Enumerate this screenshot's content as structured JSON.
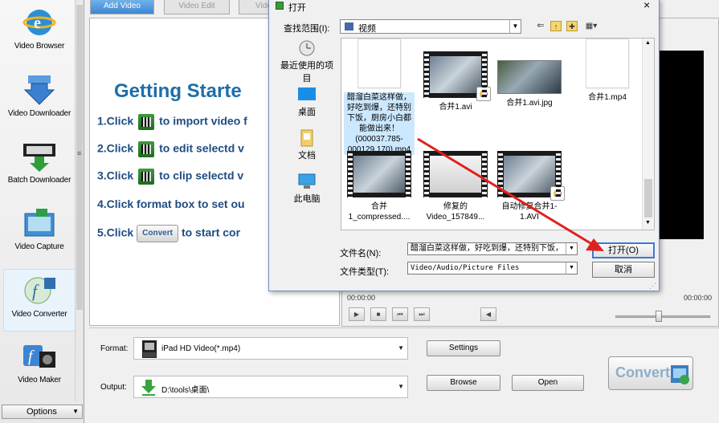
{
  "sidebar": {
    "items": [
      {
        "label": "Video Browser",
        "icon": "globe-icon"
      },
      {
        "label": "Video Downloader",
        "icon": "download-arrow-icon"
      },
      {
        "label": "Batch Downloader",
        "icon": "film-download-icon"
      },
      {
        "label": "Video Capture",
        "icon": "camera-capture-icon"
      },
      {
        "label": "Video Converter",
        "icon": "converter-icon"
      },
      {
        "label": "Video Maker",
        "icon": "video-maker-icon"
      }
    ],
    "options_label": "Options"
  },
  "tabs": [
    {
      "label": "Add Video",
      "active": true
    },
    {
      "label": "Video Edit",
      "active": false
    },
    {
      "label": "Vide",
      "active": false
    }
  ],
  "getting_started": {
    "title": "Getting Starte",
    "steps": [
      {
        "prefix": "1.Click",
        "suffix": "to import video f"
      },
      {
        "prefix": "2.Click",
        "suffix": "to edit selectd v"
      },
      {
        "prefix": "3.Click",
        "suffix": "to clip selectd v"
      },
      {
        "prefix": "4.Click format box to set ou",
        "suffix": ""
      },
      {
        "prefix": "5.Click",
        "button": "Convert",
        "suffix": "to start cor"
      }
    ]
  },
  "player": {
    "time_current": "00:00:00",
    "time_total": "00:00:00",
    "controls": [
      "play",
      "stop",
      "prev",
      "next"
    ],
    "volume_fraction": 0.46
  },
  "bottom": {
    "format_label": "Format:",
    "format_value": "iPad HD Video(*.mp4)",
    "settings_label": "Settings",
    "output_label": "Output:",
    "output_value": "D:\\tools\\桌面\\",
    "browse_label": "Browse",
    "open_label": "Open",
    "convert_label": "Convert"
  },
  "dialog": {
    "title": "打开",
    "close": "×",
    "lookin_label": "查找范围(I):",
    "lookin_value": "视频",
    "places": [
      {
        "label": "最近使用的项目",
        "icon": "recent-items-icon"
      },
      {
        "label": "桌面",
        "icon": "desktop-icon"
      },
      {
        "label": "文档",
        "icon": "documents-icon"
      },
      {
        "label": "此电脑",
        "icon": "this-pc-icon"
      }
    ],
    "files": [
      {
        "caption": "醋溜白菜这样做，好吃到爆，还特别下饭，厨房小白都能做出来！(000037.785-000129.170).mp4",
        "type": "doc",
        "selected": true
      },
      {
        "caption": "合并1.avi",
        "type": "video"
      },
      {
        "caption": "合并1.avi.jpg",
        "type": "image"
      },
      {
        "caption": "合井1.mp4",
        "type": "doc"
      },
      {
        "caption": "合并1_compressed....",
        "type": "video"
      },
      {
        "caption": "修复的Video_157849...",
        "type": "video"
      },
      {
        "caption": "自动修复合并1-1.AVI",
        "type": "video"
      }
    ],
    "filename_label": "文件名(N):",
    "filename_value": "醋溜白菜这样做，好吃到爆，还特别下饭，",
    "filetype_label": "文件类型(T):",
    "filetype_value": "Video/Audio/Picture Files",
    "open_label": "打开(O)",
    "cancel_label": "取消"
  }
}
